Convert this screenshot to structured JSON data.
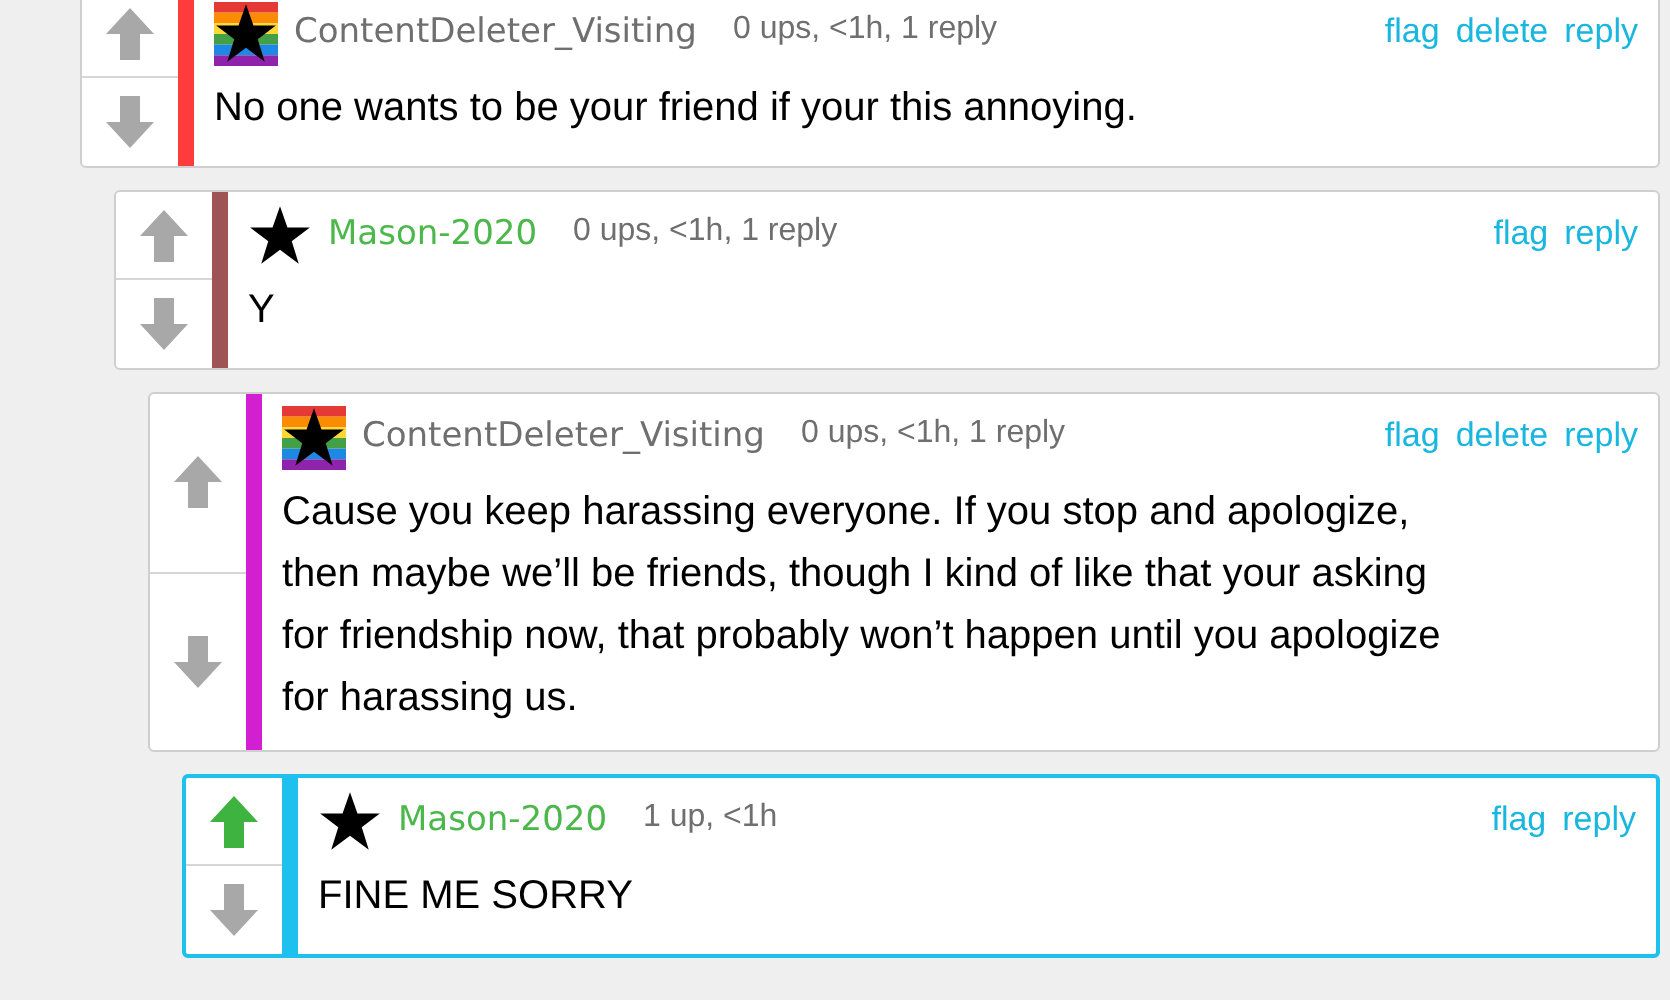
{
  "comments": [
    {
      "user": {
        "kind": "rainbow-star",
        "name": "ContentDeleter_Visiting",
        "color": "#6f6f6f"
      },
      "meta": "0 ups, <1h, 1 reply",
      "actions": [
        "flag",
        "delete",
        "reply"
      ],
      "color": "#ff3b3b",
      "upvoted": false,
      "highlighted": false,
      "text": "No one wants to be your friend if your this annoying.",
      "children": [
        {
          "user": {
            "kind": "star",
            "name": "Mason-2020",
            "color": "#4cb84c"
          },
          "meta": "0 ups, <1h, 1 reply",
          "actions": [
            "flag",
            "reply"
          ],
          "color": "#9e5454",
          "upvoted": false,
          "highlighted": false,
          "text": "Y",
          "children": [
            {
              "user": {
                "kind": "rainbow-star",
                "name": "ContentDeleter_Visiting",
                "color": "#6f6f6f"
              },
              "meta": "0 ups, <1h, 1 reply",
              "actions": [
                "flag",
                "delete",
                "reply"
              ],
              "color": "#d21fd2",
              "upvoted": false,
              "highlighted": false,
              "text": "Cause you keep harassing everyone. If you stop and apologize, then maybe we’ll be friends, though I kind of like that your asking for friendship now, that probably won’t happen until you apologize for harassing us.",
              "children": [
                {
                  "user": {
                    "kind": "star",
                    "name": "Mason-2020",
                    "color": "#4cb84c"
                  },
                  "meta": "1 up, <1h",
                  "actions": [
                    "flag",
                    "reply"
                  ],
                  "color": "#1ec0ee",
                  "upvoted": true,
                  "highlighted": true,
                  "text": "FINE ME SORRY"
                }
              ]
            }
          ]
        }
      ]
    }
  ]
}
